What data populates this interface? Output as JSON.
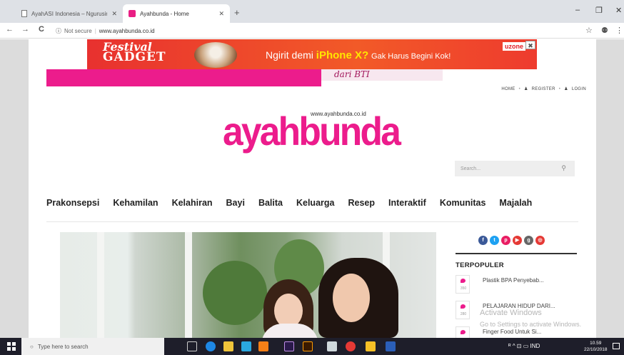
{
  "browser": {
    "tabs": [
      {
        "title": "AyahASI Indonesia – Ngurusinya",
        "active": false
      },
      {
        "title": "Ayahbunda - Home",
        "active": true
      }
    ],
    "new_tab": "+",
    "window_controls": {
      "minimize": "–",
      "restore": "❐",
      "close": "✕"
    },
    "nav": {
      "back": "←",
      "forward": "→",
      "reload": "C"
    },
    "address": {
      "info": "ⓘ",
      "security_label": "Not secure",
      "url": "www.ayahbunda.co.id"
    },
    "star": "☆",
    "extension": "⚉",
    "menu": "⋮"
  },
  "ad": {
    "festival": "Festival",
    "gadget": "GADGET",
    "headline_prefix": "Ngirit demi",
    "headline_brand": "iPhone X?",
    "headline_suffix": "Gak Harus Begini Kok!",
    "sponsor": "uzone",
    "close": "✖"
  },
  "promo": {
    "text": "dari BTI"
  },
  "topnav": {
    "home": "HOME",
    "register": "REGISTER",
    "login": "LOGIN",
    "separator": "•"
  },
  "logo": {
    "url_text": "www.ayahbunda.co.id",
    "name": "ayahbunda"
  },
  "search": {
    "placeholder": "Search...",
    "icon": "search-icon",
    "icon_glyph": "⚲"
  },
  "mainnav": [
    "Prakonsepsi",
    "Kehamilan",
    "Kelahiran",
    "Bayi",
    "Balita",
    "Keluarga",
    "Resep",
    "Interaktif",
    "Komunitas",
    "Majalah"
  ],
  "social": [
    {
      "name": "facebook-icon",
      "glyph": "f",
      "color": "#3b5998"
    },
    {
      "name": "twitter-icon",
      "glyph": "t",
      "color": "#1da1f2"
    },
    {
      "name": "pinterest-icon",
      "glyph": "p",
      "color": "#e91e63"
    },
    {
      "name": "youtube-icon",
      "glyph": "▶",
      "color": "#e53935"
    },
    {
      "name": "googleplus-icon",
      "glyph": "g",
      "color": "#666666"
    },
    {
      "name": "instagram-icon",
      "glyph": "◎",
      "color": "#e53935"
    }
  ],
  "sidebar": {
    "heading": "TERPOPULER",
    "items": [
      {
        "title": "Plastik BPA Penyebab...",
        "count": "350"
      },
      {
        "title": "PELAJARAN HIDUP DARI...",
        "count": "280"
      },
      {
        "title": "Finger Food Untuk Si...",
        "count": ""
      }
    ]
  },
  "watermark": {
    "line1": "Activate Windows",
    "line2": "Go to Settings to activate Windows."
  },
  "taskbar": {
    "search_placeholder": "Type here to search",
    "search_glyph": "○",
    "tray_text": "ᴿ  ^  ⊡  ▭  IND",
    "time": "10.59",
    "date": "22/10/2018"
  },
  "colors": {
    "brand_pink": "#ec1c8c",
    "ad_red": "#e8312f",
    "taskbar": "#1e1e2a"
  }
}
